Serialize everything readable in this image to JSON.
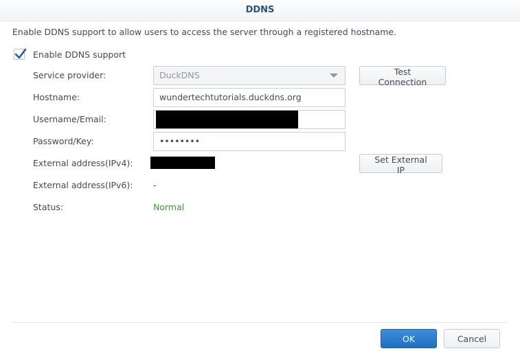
{
  "dialog": {
    "title": "DDNS",
    "description": "Enable DDNS support to allow users to access the server through a registered hostname.",
    "enable_label": "Enable DDNS support",
    "enable_checked": true
  },
  "form": {
    "service_provider": {
      "label": "Service provider:",
      "value": "DuckDNS"
    },
    "hostname": {
      "label": "Hostname:",
      "value": "wundertechtutorials.duckdns.org"
    },
    "username": {
      "label": "Username/Email:"
    },
    "password": {
      "label": "Password/Key:",
      "value": "••••••••"
    },
    "ext_ipv4": {
      "label": "External address(IPv4):"
    },
    "ext_ipv6": {
      "label": "External address(IPv6):",
      "value": "-"
    },
    "status": {
      "label": "Status:",
      "value": "Normal",
      "color": "#3a9a35"
    }
  },
  "buttons": {
    "test_connection": "Test Connection",
    "set_external_ip": "Set External IP",
    "ok": "OK",
    "cancel": "Cancel"
  },
  "colors": {
    "title": "#2a5286",
    "primary": "#1f6fbf",
    "check": "#1f5fa8"
  }
}
